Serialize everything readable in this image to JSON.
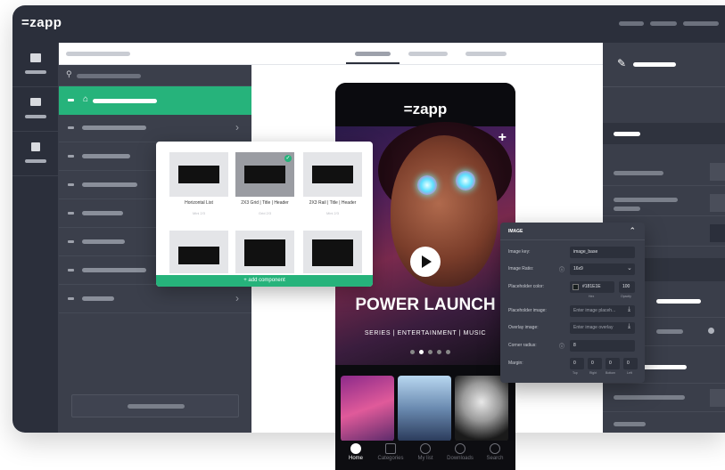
{
  "app": {
    "logo": "zapp"
  },
  "phone": {
    "logo": "zapp",
    "hero_title": "POWER LAUNCH",
    "hero_subtitle": "SERIES | ENTERTAINMENT | MUSIC",
    "add_symbol": "+",
    "tabs": [
      {
        "label": "Home",
        "active": true
      },
      {
        "label": "Categories"
      },
      {
        "label": "My list"
      },
      {
        "label": "Downloads"
      },
      {
        "label": "Search"
      }
    ]
  },
  "component_picker": {
    "tiles": [
      {
        "label": "Horizontal List",
        "sub": "Mini 2/3"
      },
      {
        "label": "2X3 Grid | Title | Header",
        "sub": "Grid 2/3"
      },
      {
        "label": "2X3 Rail | Title | Header",
        "sub": "Mini 2/3"
      }
    ],
    "add_label": "+ add component"
  },
  "image_panel": {
    "title": "IMAGE",
    "fields": [
      {
        "label": "Image key:",
        "value": "image_base"
      },
      {
        "label": "Image Ratio:",
        "value": "16x9"
      },
      {
        "label": "Placeholder color:",
        "value": "#181E1E",
        "extra": "100",
        "sub1": "Hex",
        "sub2": "Opacity"
      },
      {
        "label": "Placeholder image:",
        "value": "Enter image placeh..."
      },
      {
        "label": "Overlay image:",
        "value": "Enter image overlay"
      },
      {
        "label": "Corner radius:",
        "value": "8"
      },
      {
        "label": "Margin:",
        "values": [
          "0",
          "0",
          "0",
          "0"
        ],
        "sides": [
          "Top",
          "Right",
          "Bottom",
          "Left"
        ]
      }
    ]
  },
  "colors": {
    "accent": "#26b37b",
    "dark": "#2b2f3b",
    "panel": "#3a3e4a"
  }
}
